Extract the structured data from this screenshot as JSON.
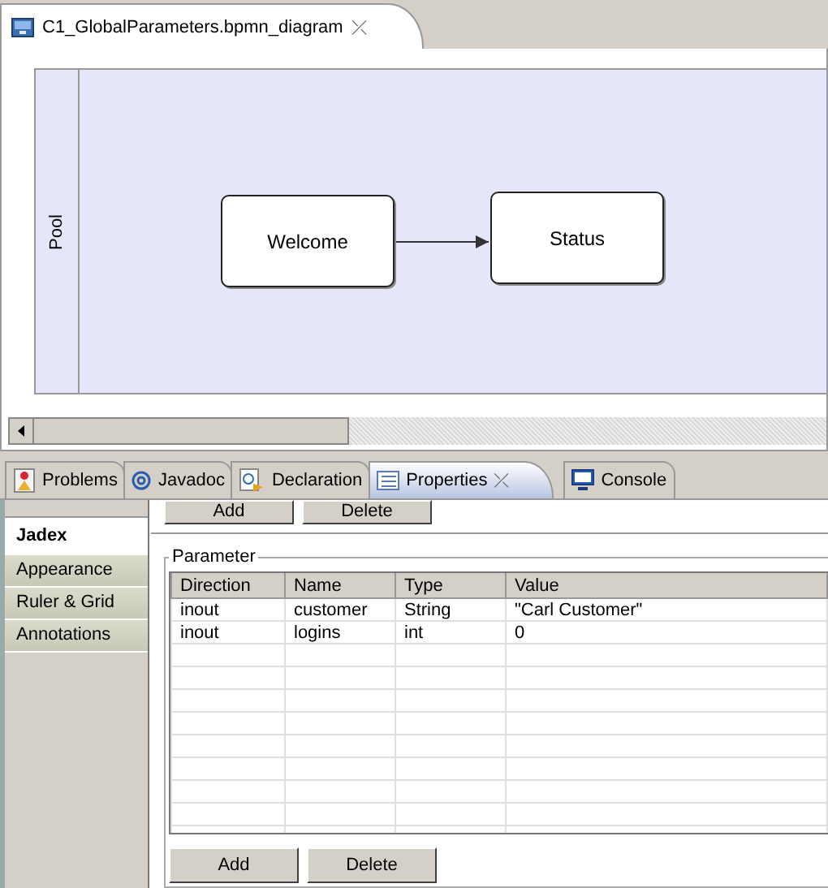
{
  "editor_tab": {
    "title": "C1_GlobalParameters.bpmn_diagram",
    "close": "⤫"
  },
  "diagram": {
    "pool": {
      "label": "Pool"
    },
    "tasks": [
      {
        "label": "Welcome"
      },
      {
        "label": "Status"
      }
    ]
  },
  "view_tabs": [
    {
      "label": "Problems",
      "kind": "problems",
      "selected": false
    },
    {
      "label": "Javadoc",
      "kind": "at",
      "selected": false
    },
    {
      "label": "Declaration",
      "kind": "declaration",
      "selected": false
    },
    {
      "label": "Properties",
      "kind": "properties",
      "selected": true
    },
    {
      "label": "Console",
      "kind": "console",
      "selected": false
    }
  ],
  "view_close": "⤫",
  "property_tabs": [
    {
      "label": "Jadex",
      "selected": true
    },
    {
      "label": "Appearance",
      "selected": false
    },
    {
      "label": "Ruler & Grid",
      "selected": false
    },
    {
      "label": "Annotations",
      "selected": false
    }
  ],
  "top_buttons": [
    "Add",
    "Delete"
  ],
  "parameter": {
    "title": "Parameter",
    "columns": [
      "Direction",
      "Name",
      "Type",
      "Value"
    ],
    "rows": [
      [
        "inout",
        "customer",
        "String",
        "\"Carl Customer\""
      ],
      [
        "inout",
        "logins",
        "int",
        "0"
      ]
    ],
    "buttons": [
      "Add",
      "Delete"
    ]
  }
}
